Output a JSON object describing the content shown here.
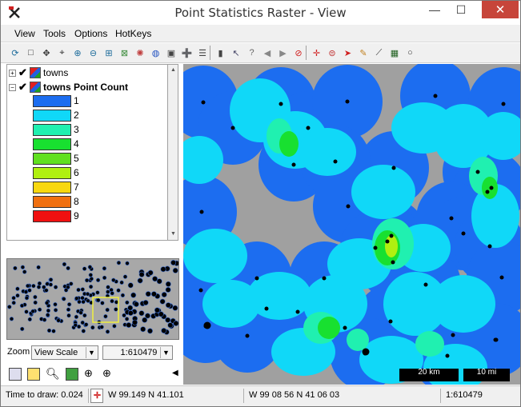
{
  "window": {
    "title": "Point Statistics Raster - View",
    "minimize": "—",
    "maximize": "☐",
    "close": "✕"
  },
  "menu": [
    {
      "label": "View"
    },
    {
      "label": "Tools"
    },
    {
      "label": "Options"
    },
    {
      "label": "HotKeys"
    }
  ],
  "toolbar": {
    "icons": [
      "redraw-icon",
      "full-extent-icon",
      "pan-icon",
      "zoom-box-icon",
      "zoom-in-icon",
      "zoom-out-icon",
      "zoom-to-layer-icon",
      "zoom-to-selection-icon",
      "gps-icon",
      "globe-icon",
      "snapshot-icon",
      "add-layer-icon",
      "layer-manager-icon",
      "select-icon",
      "select-point-icon",
      "query-icon",
      "back-icon",
      "forward-icon",
      "cancel-icon",
      "move-icon",
      "zoom-tool-icon",
      "pointer-icon",
      "pencil-icon",
      "measure-icon",
      "image-icon",
      "select-circle-icon"
    ]
  },
  "legend": {
    "layers": [
      {
        "name": "towns",
        "expander": "+",
        "checked": "✔"
      },
      {
        "name": "towns Point Count",
        "expander": "−",
        "checked": "✔"
      }
    ],
    "entries": [
      {
        "label": "1",
        "color": "#1c6df0"
      },
      {
        "label": "2",
        "color": "#10d8f8"
      },
      {
        "label": "3",
        "color": "#20f0b0"
      },
      {
        "label": "4",
        "color": "#18e030"
      },
      {
        "label": "5",
        "color": "#60e020"
      },
      {
        "label": "6",
        "color": "#b0f010"
      },
      {
        "label": "7",
        "color": "#f8d810"
      },
      {
        "label": "8",
        "color": "#f07010"
      },
      {
        "label": "9",
        "color": "#f01010"
      }
    ]
  },
  "zoom": {
    "label": "Zoom",
    "mode": "View Scale",
    "scale": "1:610479"
  },
  "scalebars": [
    {
      "label": "20 km"
    },
    {
      "label": "10 mi"
    }
  ],
  "status": {
    "draw_time": "Time to draw: 0.024",
    "coords_decimal": "W 99.149  N 41.101",
    "coords_dms": "W 99 08 56  N 41 06 03",
    "scale": "1:610479"
  },
  "colors": {
    "background": "#a0a0a0",
    "dot": "#000000"
  }
}
